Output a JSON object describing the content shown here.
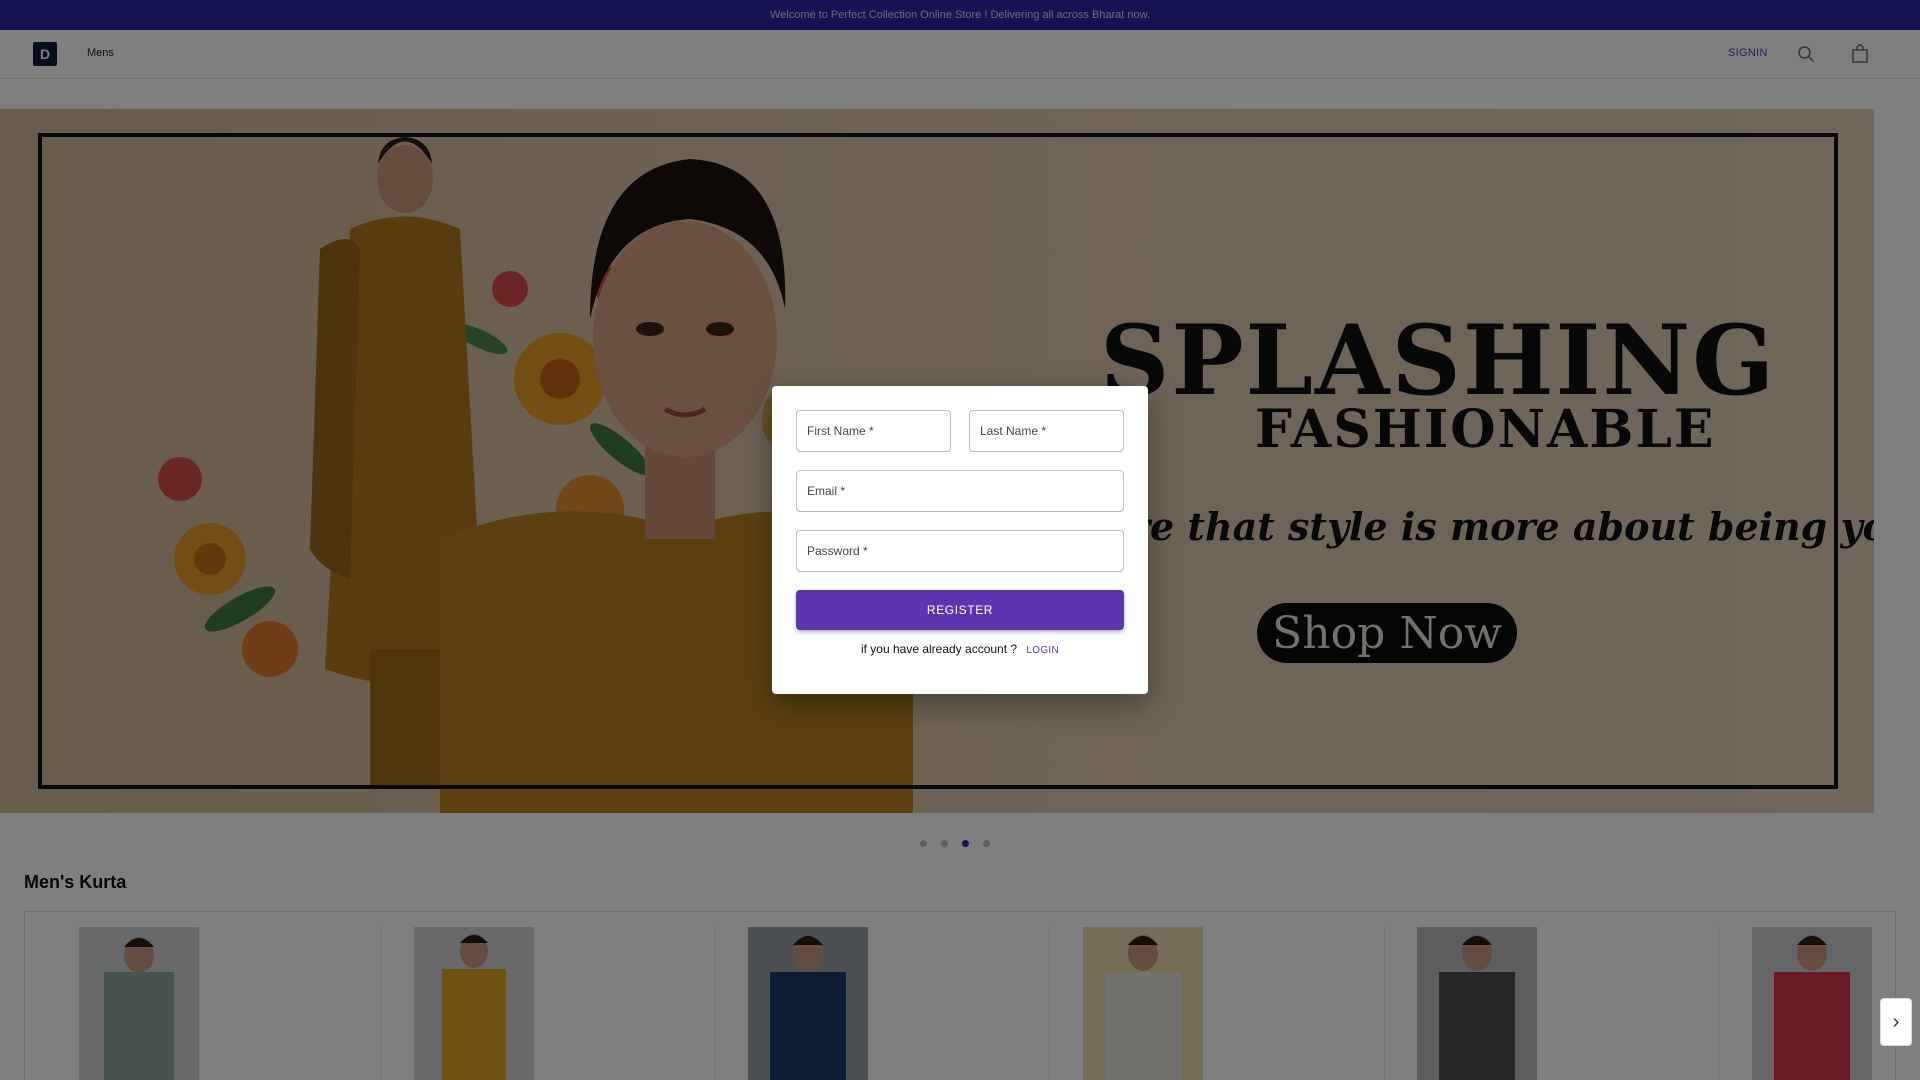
{
  "announcement": "Welcome to Perfect Collection Online Store ! Delivering all across Bharat now.",
  "nav": {
    "logo_letter": "D",
    "mens": "Mens",
    "signin": "SIGNIN",
    "search_icon": "search-icon",
    "bag_icon": "shopping-bag-icon"
  },
  "banner": {
    "title": "SPLASHING",
    "subtitle": "FASHIONABLE",
    "tagline": "re that style is more about being yourself.",
    "cta": "Shop Now",
    "carousel_dots": 4,
    "active_dot": 3
  },
  "section": {
    "title": "Men's Kurta"
  },
  "products": [
    {
      "color": "#8fa7a0"
    },
    {
      "color": "#e3a321"
    },
    {
      "color": "#1d3a66"
    },
    {
      "color": "#e6e4df"
    },
    {
      "color": "#4a4d50"
    },
    {
      "color": "#d5374a"
    }
  ],
  "register_form": {
    "first_name_placeholder": "First Name *",
    "last_name_placeholder": "Last Name *",
    "email_placeholder": "Email *",
    "password_placeholder": "Password *",
    "register_label": "REGISTER",
    "login_prompt": "if you have already account ?",
    "login_label": "LOGIN"
  },
  "colors": {
    "announcement_bg": "#2d26a6",
    "accent": "#5e35b1"
  }
}
